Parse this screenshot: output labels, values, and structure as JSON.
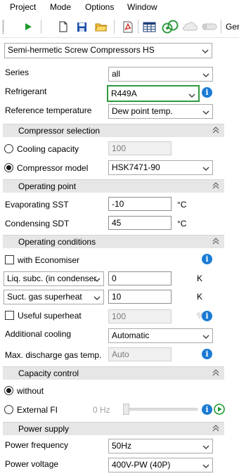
{
  "menu": [
    "Project",
    "Mode",
    "Options",
    "Window"
  ],
  "toolbar": {
    "trailing_label": "Ger"
  },
  "product": {
    "selected": "Semi-hermetic Screw Compressors HS"
  },
  "series": {
    "label": "Series",
    "value": "all"
  },
  "refrigerant": {
    "label": "Refrigerant",
    "value": "R449A"
  },
  "reference_temperature": {
    "label": "Reference temperature",
    "value": "Dew point temp."
  },
  "sections": {
    "compressor_selection": "Compressor selection",
    "operating_point": "Operating point",
    "operating_conditions": "Operating conditions",
    "capacity_control": "Capacity control",
    "power_supply": "Power supply"
  },
  "compressor_selection": {
    "cooling_capacity_label": "Cooling capacity",
    "cooling_capacity_value": "100",
    "compressor_model_label": "Compressor model",
    "compressor_model_value": "HSK7471-90",
    "selected_mode": "Compressor model"
  },
  "operating_point": {
    "evap_label": "Evaporating SST",
    "evap_value": "-10",
    "evap_unit": "°C",
    "cond_label": "Condensing SDT",
    "cond_value": "45",
    "cond_unit": "°C"
  },
  "operating_conditions": {
    "economiser_label": "with Economiser",
    "economiser_checked": false,
    "liq_subc_select": "Liq. subc. (in condenser",
    "liq_subc_value": "0",
    "liq_subc_unit": "K",
    "suct_gas_select": "Suct. gas superheat",
    "suct_gas_value": "10",
    "suct_gas_unit": "K",
    "useful_superheat_label": "Useful superheat",
    "useful_superheat_value": "100",
    "useful_superheat_unit": "%",
    "useful_superheat_checked": false,
    "additional_cooling_label": "Additional cooling",
    "additional_cooling_value": "Automatic",
    "max_discharge_label": "Max. discharge gas temp.",
    "max_discharge_value": "Auto"
  },
  "capacity_control": {
    "without_label": "without",
    "external_fi_label": "External FI",
    "hz_label": "0 Hz",
    "selected": "without",
    "slider_level": 0
  },
  "power_supply": {
    "frequency_label": "Power frequency",
    "frequency_value": "50Hz",
    "voltage_label": "Power voltage",
    "voltage_value": "400V-PW (40P)"
  },
  "colors": {
    "accent_info": "#1a7ad4",
    "refrigerant_highlight": "#2e9a3e",
    "section_bg": "#e6e6e6",
    "run_green": "#1e9a2e"
  },
  "icons": [
    "grip-icon",
    "run-icon",
    "new-document-icon",
    "save-icon",
    "open-folder-icon",
    "pdf-icon",
    "table-icon",
    "refrigerant-icon",
    "cloud-icon",
    "compressor-icon",
    "chevron-down-icon",
    "info-icon",
    "collapse-icon",
    "play-icon"
  ]
}
